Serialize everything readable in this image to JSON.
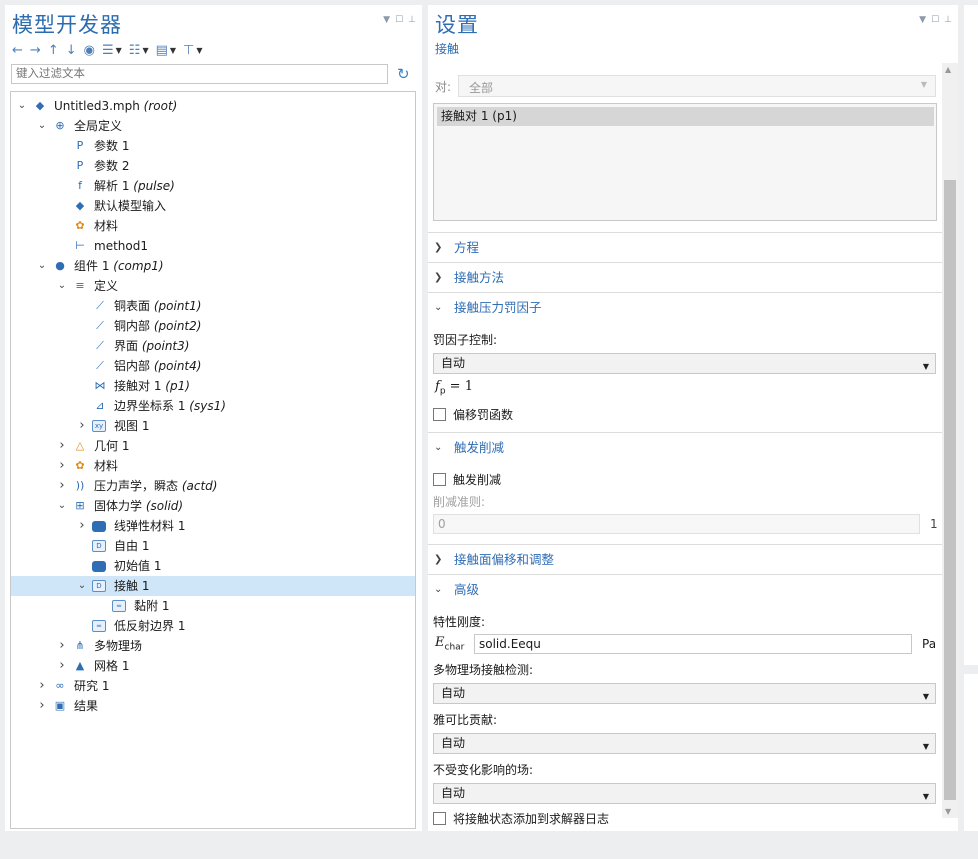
{
  "model_builder": {
    "title": "模型开发器",
    "filter_placeholder": "键入过滤文本",
    "tree": [
      {
        "label": "Untitled3.mph",
        "tag": "(root)"
      },
      {
        "label": "全局定义",
        "tag": ""
      },
      {
        "label": "参数 1",
        "tag": ""
      },
      {
        "label": "参数 2",
        "tag": ""
      },
      {
        "label": "解析 1",
        "tag": "(pulse)"
      },
      {
        "label": "默认模型输入",
        "tag": ""
      },
      {
        "label": "材料",
        "tag": ""
      },
      {
        "label": "method1",
        "tag": ""
      },
      {
        "label": "组件 1",
        "tag": "(comp1)"
      },
      {
        "label": "定义",
        "tag": ""
      },
      {
        "label": "铜表面",
        "tag": "(point1)"
      },
      {
        "label": "铜内部",
        "tag": "(point2)"
      },
      {
        "label": "界面",
        "tag": "(point3)"
      },
      {
        "label": "铝内部",
        "tag": "(point4)"
      },
      {
        "label": "接触对 1",
        "tag": "(p1)"
      },
      {
        "label": "边界坐标系 1",
        "tag": "(sys1)"
      },
      {
        "label": "视图 1",
        "tag": ""
      },
      {
        "label": "几何 1",
        "tag": ""
      },
      {
        "label": "材料",
        "tag": ""
      },
      {
        "label": "压力声学，瞬态",
        "tag": "(actd)"
      },
      {
        "label": "固体力学",
        "tag": "(solid)"
      },
      {
        "label": "线弹性材料 1",
        "tag": ""
      },
      {
        "label": "自由 1",
        "tag": ""
      },
      {
        "label": "初始值 1",
        "tag": ""
      },
      {
        "label": "接触 1",
        "tag": ""
      },
      {
        "label": "黏附 1",
        "tag": ""
      },
      {
        "label": "低反射边界 1",
        "tag": ""
      },
      {
        "label": "多物理场",
        "tag": ""
      },
      {
        "label": "网格 1",
        "tag": ""
      },
      {
        "label": "研究 1",
        "tag": ""
      },
      {
        "label": "结果",
        "tag": ""
      }
    ],
    "selected_item": "接触 1"
  },
  "settings": {
    "title": "设置",
    "subtitle": "接触",
    "pair_label": "对:",
    "pair_select_value": "全部",
    "pair_list": [
      "接触对 1 (p1)"
    ],
    "sections": {
      "equation": "方程",
      "contact_method": "接触方法",
      "penalty": "接触压力罚因子",
      "trigger_reduction": "触发削减",
      "offset": "接触面偏移和调整",
      "advanced": "高级"
    },
    "penalty_control_label": "罚因子控制:",
    "penalty_control_value": "自动",
    "fp_symbol": "f",
    "fp_sub": "p",
    "fp_value": "= 1",
    "offset_penalty_label": "偏移罚函数",
    "trigger_reduction_check": "触发削减",
    "reduction_criterion_label": "削减准则:",
    "reduction_criterion_value": "0",
    "reduction_criterion_unit": "1",
    "char_stiffness_label": "特性刚度:",
    "echar_symbol": "E",
    "echar_sub": "char",
    "echar_value": "solid.Eequ",
    "echar_unit": "Pa",
    "multiphysics_detect_label": "多物理场接触检测:",
    "multiphysics_detect_value": "自动",
    "jacobian_label": "雅可比贡献:",
    "jacobian_value": "自动",
    "fields_label": "不受变化影响的场:",
    "fields_value": "自动",
    "add_log_label": "将接触状态添加到求解器日志"
  },
  "colors": {
    "accent": "#2f6db5",
    "selection": "#cfe5f8"
  }
}
